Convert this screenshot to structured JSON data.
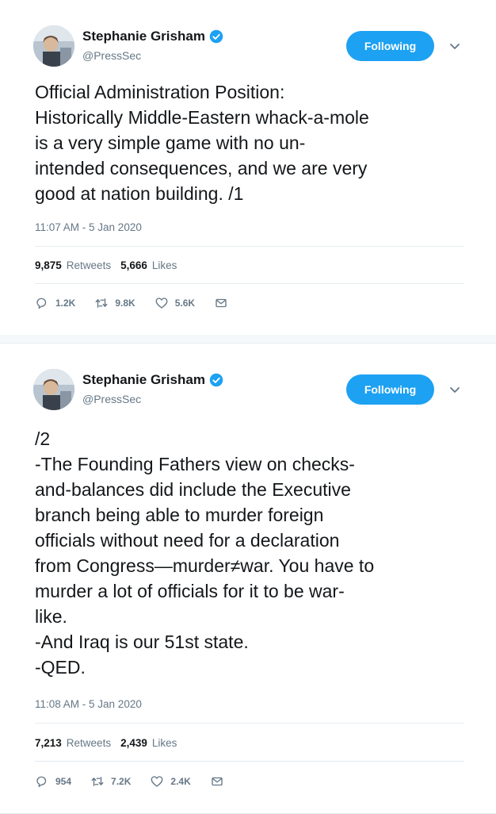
{
  "tweets": [
    {
      "display_name": "Stephanie Grisham",
      "handle": "@PressSec",
      "follow_label": "Following",
      "text": "Official Administration Position:\nHistorically Middle-Eastern whack-a-mole\nis a very simple game with no un-\nintended consequences, and we are very\ngood at nation building. /1",
      "timestamp": "11:07 AM - 5 Jan 2020",
      "retweets_count": "9,875",
      "retweets_label": "Retweets",
      "likes_count": "5,666",
      "likes_label": "Likes",
      "reply_count": "1.2K",
      "retweet_action_count": "9.8K",
      "like_action_count": "5.6K"
    },
    {
      "display_name": "Stephanie Grisham",
      "handle": "@PressSec",
      "follow_label": "Following",
      "text": "/2\n-The Founding Fathers view on checks-\nand-balances did include the Executive\nbranch being able to murder foreign\nofficials without need for a declaration\nfrom Congress—murder≠war. You have to\nmurder a lot of officials for it to be war-\nlike.\n-And Iraq is our 51st state.\n-QED.",
      "timestamp": "11:08 AM - 5 Jan 2020",
      "retweets_count": "7,213",
      "retweets_label": "Retweets",
      "likes_count": "2,439",
      "likes_label": "Likes",
      "reply_count": "954",
      "retweet_action_count": "7.2K",
      "like_action_count": "2.4K"
    }
  ],
  "colors": {
    "accent": "#1da1f2",
    "text": "#14171a",
    "muted": "#657786",
    "divider": "#e6ecf0"
  },
  "icons": [
    "avatar",
    "verified-badge-icon",
    "chevron-down-icon",
    "reply-icon",
    "retweet-icon",
    "like-icon",
    "message-icon"
  ]
}
